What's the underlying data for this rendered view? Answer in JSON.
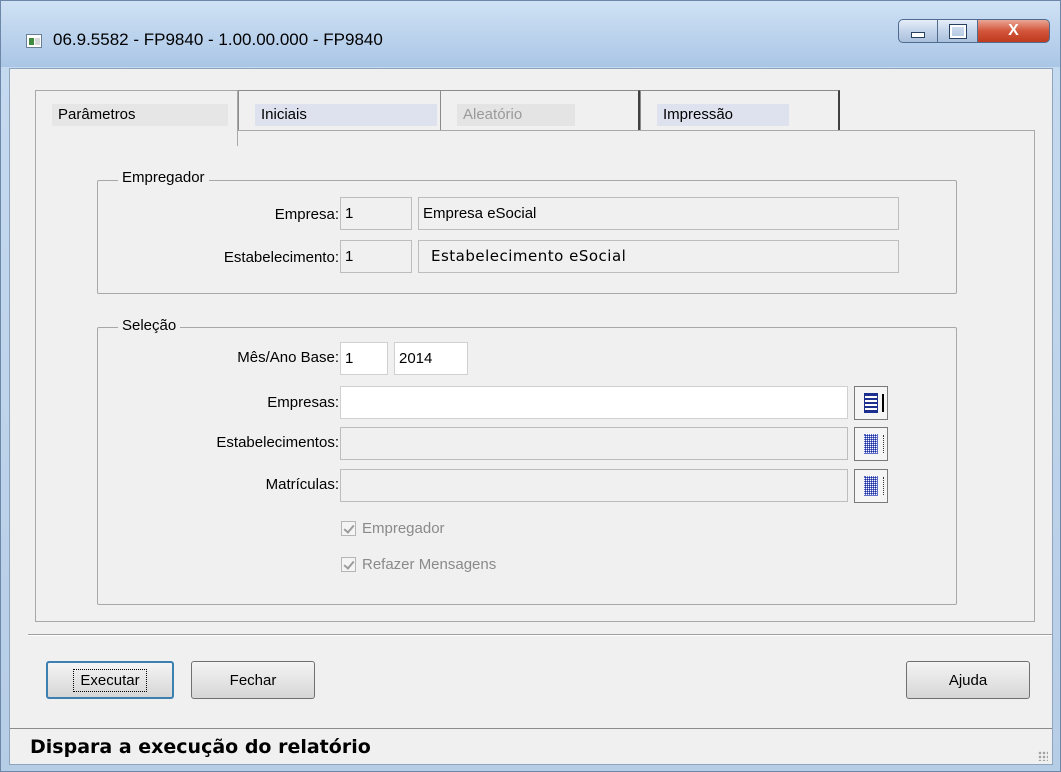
{
  "window": {
    "title": "06.9.5582 - FP9840 - 1.00.00.000 - FP9840",
    "close_glyph": "X"
  },
  "tabs": [
    {
      "label": "Parâmetros",
      "state": "active"
    },
    {
      "label": "Iniciais",
      "state": "normal"
    },
    {
      "label": "Aleatório",
      "state": "disabled"
    },
    {
      "label": "Impressão",
      "state": "normal"
    }
  ],
  "empregador": {
    "legend": "Empregador",
    "empresa_label": "Empresa:",
    "empresa_code": "1",
    "empresa_name": "Empresa eSocial",
    "estab_label": "Estabelecimento:",
    "estab_code": "1",
    "estab_name": "Estabelecimento eSocial"
  },
  "selecao": {
    "legend": "Seleção",
    "mes_ano_label": "Mês/Ano Base:",
    "mes": "1",
    "ano": "2014",
    "empresas_label": "Empresas:",
    "empresas_value": "",
    "estabelecimentos_label": "Estabelecimentos:",
    "estabelecimentos_value": "",
    "matriculas_label": "Matrículas:",
    "matriculas_value": "",
    "chk_empregador": "Empregador",
    "chk_refazer": "Refazer Mensagens"
  },
  "buttons": {
    "executar": "Executar",
    "fechar": "Fechar",
    "ajuda": "Ajuda"
  },
  "status": {
    "text": "Dispara a execução do relatório"
  }
}
